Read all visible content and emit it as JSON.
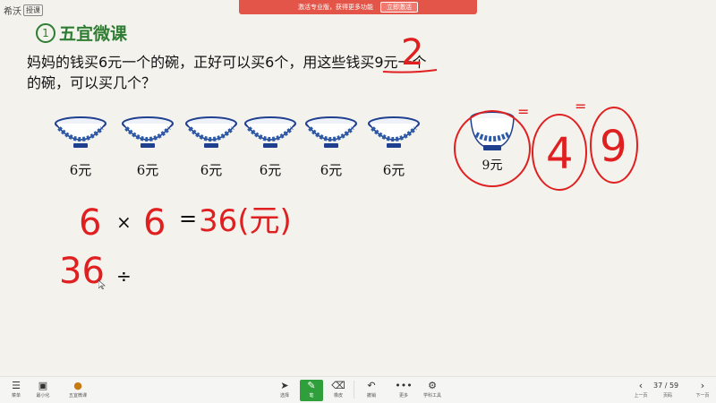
{
  "app": {
    "name": "希沃",
    "badge": "授课"
  },
  "promo": {
    "text": "激活专业版，获得更多功能",
    "button": "立即激活"
  },
  "lesson": {
    "number": "1",
    "title": "五宜微课"
  },
  "question": {
    "line1": "妈妈的钱买6元一个的碗，正好可以买6个，用这些钱买9元一个",
    "line2": "的碗，可以买几个？"
  },
  "bowls": {
    "items": [
      {
        "price": "6元"
      },
      {
        "price": "6元"
      },
      {
        "price": "6元"
      },
      {
        "price": "6元"
      },
      {
        "price": "6元"
      },
      {
        "price": "6元"
      }
    ],
    "special": {
      "price": "9元"
    }
  },
  "handwriting": {
    "top_mark": "2",
    "eq_marks": [
      "=",
      "="
    ],
    "circled": [
      "4",
      "9"
    ],
    "row1": {
      "a": "6",
      "op": "×",
      "b": "6",
      "eq": "=",
      "result": "36(元)"
    },
    "row2": {
      "a": "36",
      "op": "÷"
    }
  },
  "colors": {
    "ink": "#e02020",
    "accent": "#2e7d32",
    "promo": "#e25548"
  },
  "toolbar": {
    "left": [
      {
        "icon": "menu-icon",
        "label": "菜单"
      },
      {
        "icon": "minimize-icon",
        "label": "最小化"
      },
      {
        "icon": "lesson-icon",
        "label": "五宜微课"
      }
    ],
    "center": [
      {
        "icon": "cursor-icon",
        "label": "选择"
      },
      {
        "icon": "pen-icon",
        "label": "笔"
      },
      {
        "icon": "eraser-icon",
        "label": "橡皮"
      },
      {
        "icon": "undo-icon",
        "label": "撤销"
      },
      {
        "icon": "more-icon",
        "label": "更多"
      },
      {
        "icon": "tools-icon",
        "label": "学科工具"
      }
    ],
    "right": [
      {
        "icon": "prev-icon",
        "label": "上一页"
      },
      {
        "icon": "next-icon",
        "label": "下一页"
      }
    ],
    "page": {
      "label": "页码",
      "current": "37",
      "total": "59",
      "text": "37 / 59"
    }
  }
}
